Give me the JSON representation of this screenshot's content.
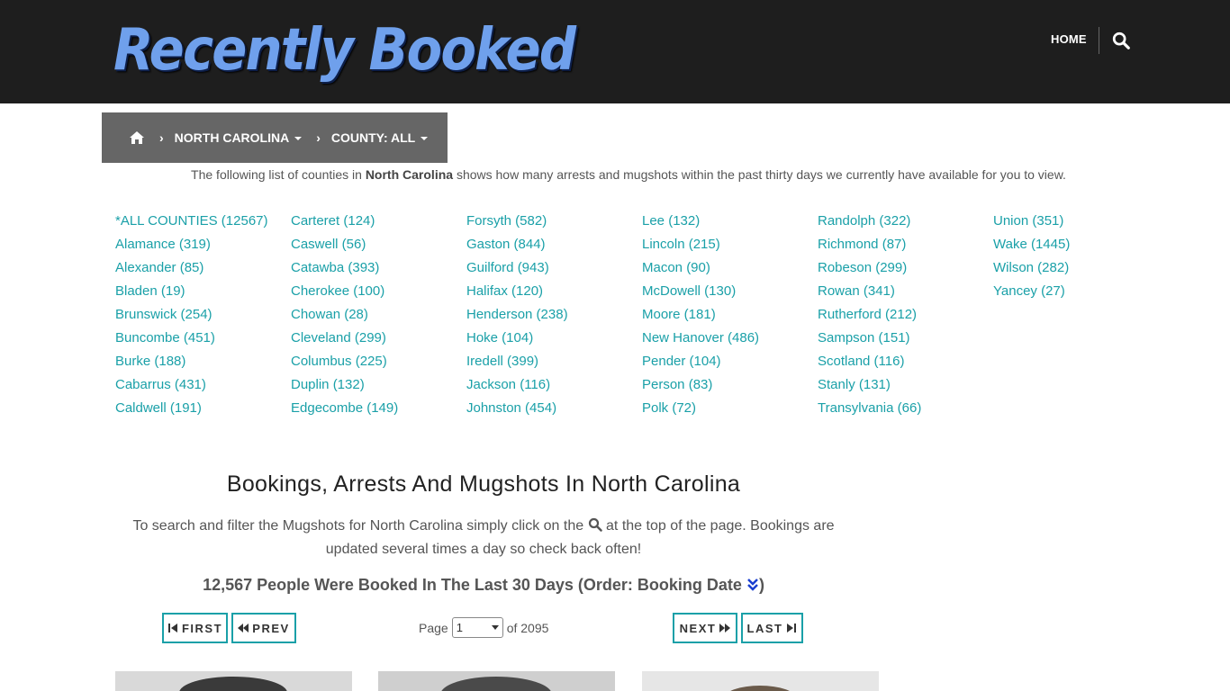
{
  "header": {
    "logo_text": "Recently Booked",
    "nav_home": "HOME",
    "search_icon": "search-icon"
  },
  "breadcrumb": {
    "home_icon": "home-icon",
    "state": "NORTH CAROLINA",
    "county": "COUNTY: ALL"
  },
  "intro": {
    "prefix": "The following list of counties in",
    "state": "North Carolina",
    "suffix": "shows how many arrests and mugshots within the past thirty days we currently have available for you to view."
  },
  "counties": [
    "*ALL COUNTIES (12567)",
    "Alamance (319)",
    "Alexander (85)",
    "Bladen (19)",
    "Brunswick (254)",
    "Buncombe (451)",
    "Burke (188)",
    "Cabarrus (431)",
    "Caldwell (191)",
    "Carteret (124)",
    "Caswell (56)",
    "Catawba (393)",
    "Cherokee (100)",
    "Chowan (28)",
    "Cleveland (299)",
    "Columbus (225)",
    "Duplin (132)",
    "Edgecombe (149)",
    "Forsyth (582)",
    "Gaston (844)",
    "Guilford (943)",
    "Halifax (120)",
    "Henderson (238)",
    "Hoke (104)",
    "Iredell (399)",
    "Jackson (116)",
    "Johnston (454)",
    "Lee (132)",
    "Lincoln (215)",
    "Macon (90)",
    "McDowell (130)",
    "Moore (181)",
    "New Hanover (486)",
    "Pender (104)",
    "Person (83)",
    "Polk (72)",
    "Randolph (322)",
    "Richmond (87)",
    "Robeson (299)",
    "Rowan (341)",
    "Rutherford (212)",
    "Sampson (151)",
    "Scotland (116)",
    "Stanly (131)",
    "Transylvania (66)",
    "Union (351)",
    "Wake (1445)",
    "Wilson (282)",
    "Yancey (27)"
  ],
  "section": {
    "title": "Bookings, Arrests And Mugshots In North Carolina",
    "desc_before": "To search and filter the Mugshots for North Carolina simply click on the",
    "desc_after": "at the top of the page. Bookings are updated several times a day so check back often!",
    "booked_text": "12,567 People Were Booked In The Last 30 Days (Order: Booking Date",
    "booked_close": ")"
  },
  "pagination": {
    "first": "FIRST",
    "prev": "PREV",
    "next": "NEXT",
    "last": "LAST",
    "page_label": "Page",
    "page_value": "1",
    "of_label": "of 2095"
  },
  "colors": {
    "accent": "#1aa0a8",
    "header_bg": "#1e1e1e",
    "breadcrumb_bg": "#666666"
  }
}
